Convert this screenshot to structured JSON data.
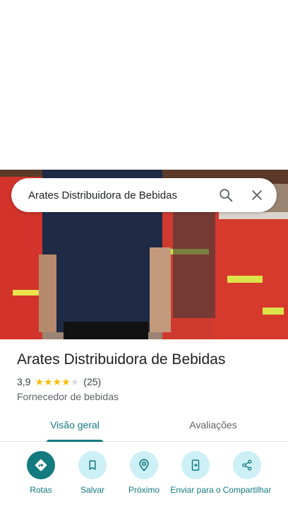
{
  "search": {
    "query": "Arates Distribuidora de Bebidas",
    "search_icon": "search-icon",
    "close_icon": "close-icon"
  },
  "place": {
    "name": "Arates Distribuidora de Bebidas",
    "rating": "3,9",
    "rating_value": 3.9,
    "stars_filled": 4,
    "stars_total": 5,
    "review_count": "(25)",
    "category": "Fornecedor de bebidas"
  },
  "tabs": [
    {
      "label": "Visão geral",
      "selected": true
    },
    {
      "label": "Avaliações",
      "selected": false
    }
  ],
  "actions": [
    {
      "label": "Rotas",
      "icon": "directions-icon"
    },
    {
      "label": "Salvar",
      "icon": "bookmark-icon"
    },
    {
      "label": "Próximo",
      "icon": "nearby-icon"
    },
    {
      "label": "Enviar para o",
      "icon": "send-to-phone-icon"
    },
    {
      "label": "Compartilhar",
      "icon": "share-icon"
    }
  ],
  "colors": {
    "accent": "#137a7f",
    "action_bg": "#cdf0f6",
    "star": "#fbbc04",
    "star_empty": "#dadce0"
  }
}
